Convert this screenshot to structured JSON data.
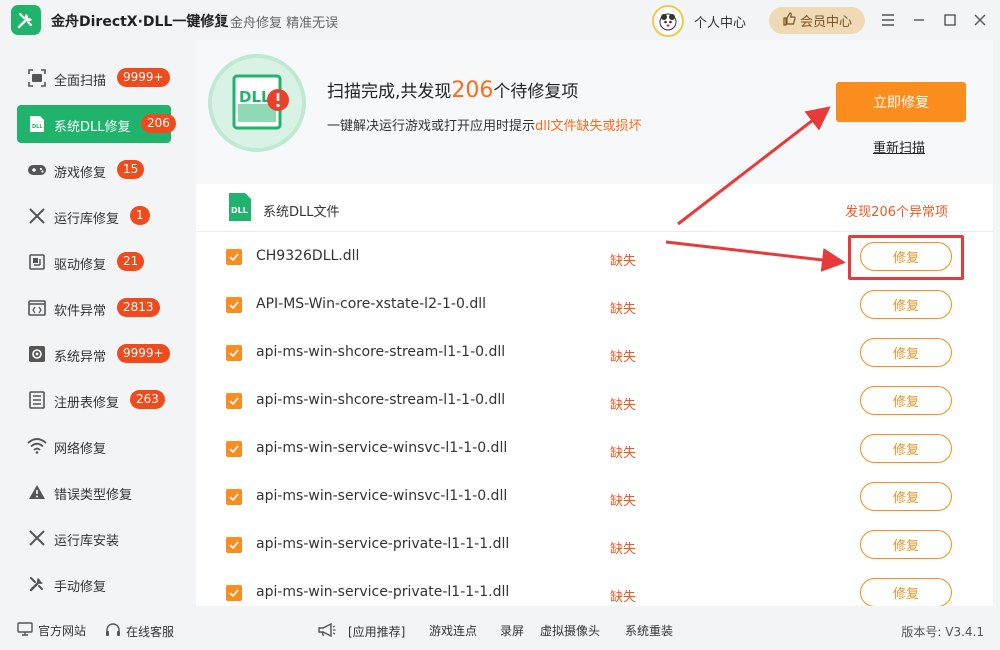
{
  "titlebar": {
    "app_title": "金舟DirectX·DLL一键修复",
    "slogan": "金舟修复 精准无误",
    "personal_center": "个人中心",
    "vip_center": "会员中心"
  },
  "sidebar": {
    "items": [
      {
        "label": "全面扫描",
        "badge": "9999+",
        "icon": "scan-icon"
      },
      {
        "label": "系统DLL修复",
        "badge": "206",
        "icon": "dll-icon"
      },
      {
        "label": "游戏修复",
        "badge": "15",
        "icon": "gamepad-icon"
      },
      {
        "label": "运行库修复",
        "badge": "1",
        "icon": "runtime-icon"
      },
      {
        "label": "驱动修复",
        "badge": "21",
        "icon": "driver-icon"
      },
      {
        "label": "软件异常",
        "badge": "2813",
        "icon": "code-icon"
      },
      {
        "label": "系统异常",
        "badge": "9999+",
        "icon": "gear-icon"
      },
      {
        "label": "注册表修复",
        "badge": "263",
        "icon": "registry-icon"
      },
      {
        "label": "网络修复",
        "badge": "",
        "icon": "wifi-icon"
      },
      {
        "label": "错误类型修复",
        "badge": "",
        "icon": "warning-icon"
      },
      {
        "label": "运行库安装",
        "badge": "",
        "icon": "install-icon"
      },
      {
        "label": "手动修复",
        "badge": "",
        "icon": "tools-icon"
      }
    ]
  },
  "hero": {
    "title_prefix": "扫描完成,共发现",
    "count": "206",
    "title_suffix": "个待修复项",
    "sub_prefix": "一键解决运行游戏或打开应用时提示",
    "sub_highlight": "dll文件缺失或损坏",
    "fix_now": "立即修复",
    "rescan": "重新扫描",
    "badge_text": "DLL"
  },
  "list": {
    "header_label": "系统DLL文件",
    "found_text": "发现206个异常项",
    "rows": [
      {
        "name": "CH9326DLL.dll",
        "status": "缺失",
        "action": "修复"
      },
      {
        "name": "API-MS-Win-core-xstate-l2-1-0.dll",
        "status": "缺失",
        "action": "修复"
      },
      {
        "name": "api-ms-win-shcore-stream-l1-1-0.dll",
        "status": "缺失",
        "action": "修复"
      },
      {
        "name": "api-ms-win-shcore-stream-l1-1-0.dll",
        "status": "缺失",
        "action": "修复"
      },
      {
        "name": "api-ms-win-service-winsvc-l1-1-0.dll",
        "status": "缺失",
        "action": "修复"
      },
      {
        "name": "api-ms-win-service-winsvc-l1-1-0.dll",
        "status": "缺失",
        "action": "修复"
      },
      {
        "name": "api-ms-win-service-private-l1-1-1.dll",
        "status": "缺失",
        "action": "修复"
      },
      {
        "name": "api-ms-win-service-private-l1-1-1.dll",
        "status": "缺失",
        "action": "修复"
      }
    ]
  },
  "footer": {
    "website": "官方网站",
    "support": "在线客服",
    "recommend": "[应用推荐]",
    "links": [
      "游戏连点",
      "录屏",
      "虚拟摄像头",
      "系统重装"
    ],
    "version": "版本号:  V3.4.1"
  },
  "colors": {
    "brand_green": "#1fb36c",
    "accent_orange": "#fb8d1f",
    "badge_red": "#ef4b1c",
    "annotation_red": "#e83a3a"
  }
}
